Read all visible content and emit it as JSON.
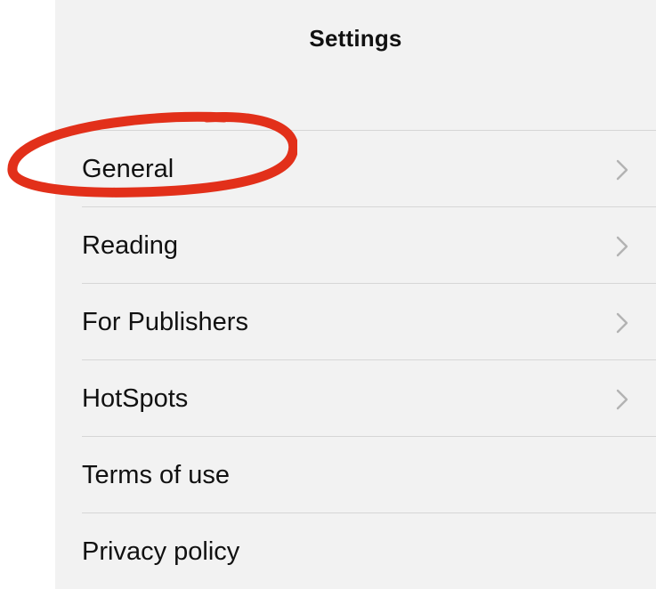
{
  "header": {
    "title": "Settings"
  },
  "settings": {
    "items": [
      {
        "label": "General",
        "icon": "chevron-right-icon"
      },
      {
        "label": "Reading",
        "icon": "chevron-right-icon"
      },
      {
        "label": "For Publishers",
        "icon": "chevron-right-icon"
      },
      {
        "label": "HotSpots",
        "icon": "chevron-right-icon"
      },
      {
        "label": "Terms of use"
      },
      {
        "label": "Privacy policy"
      }
    ]
  },
  "colors": {
    "background": "#f2f2f2",
    "separator": "#d6d6d6",
    "text": "#111111",
    "chevron": "#b3b3b3",
    "annotation": "#e2301a"
  }
}
